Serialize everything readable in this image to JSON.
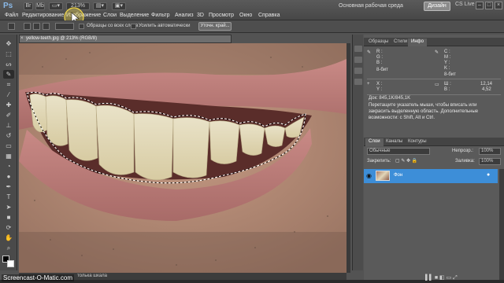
{
  "app": {
    "logo": "Ps",
    "zoom_readout": "213%"
  },
  "menu": [
    "Файл",
    "Редактирование",
    "Изображение",
    "Слои",
    "Выделение",
    "Фильтр",
    "Анализ",
    "3D",
    "Просмотр",
    "Окно",
    "Справка"
  ],
  "workspace": {
    "label": "Основная рабочая среда",
    "button": "Дизайн",
    "cs_live": "CS Live"
  },
  "options": {
    "sample_all_layers": "Образцы со всех слоев",
    "auto_enhance": "Усилить автоматически",
    "refine_edge": "Уточн. край..."
  },
  "document": {
    "tab_title": "yellow-teeth.jpg @ 213% (RGB/8)",
    "status": "толька шкала"
  },
  "info_panel": {
    "tabs": [
      "Образцы",
      "Стили",
      "Инфо"
    ],
    "rows": {
      "r": "R :",
      "g": "G :",
      "b": "B :",
      "bit_left": "8-бит",
      "c": "C :",
      "m": "M :",
      "y": "Y :",
      "k": "K :",
      "bit_right": "8-бит",
      "x": "X :",
      "y2": "Y :",
      "w": "Ш :",
      "h": "В :",
      "w_val": "12,14",
      "h_val": "4,52",
      "doc": "Док: 845,1K/845,1K"
    },
    "hint": "Перетащите указатель мыши, чтобы вписать или закрасить выделенную область. Дополнительные возможности: с Shift, Alt и Ctrl."
  },
  "layers_panel": {
    "tabs": [
      "Слои",
      "Каналы",
      "Контуры"
    ],
    "blend_mode": "Обычные",
    "opacity_label": "Непрозр.:",
    "opacity": "100%",
    "lock_label": "Закрепить:",
    "fill_label": "Заливка:",
    "fill": "100%",
    "layer_name": "Фон"
  },
  "watermark": "Screencast-O-Matic.com",
  "colors": {
    "accent_layer": "#3d8ed8",
    "ui_dark": "#535353",
    "workspace_button": "#8a8a8a"
  }
}
